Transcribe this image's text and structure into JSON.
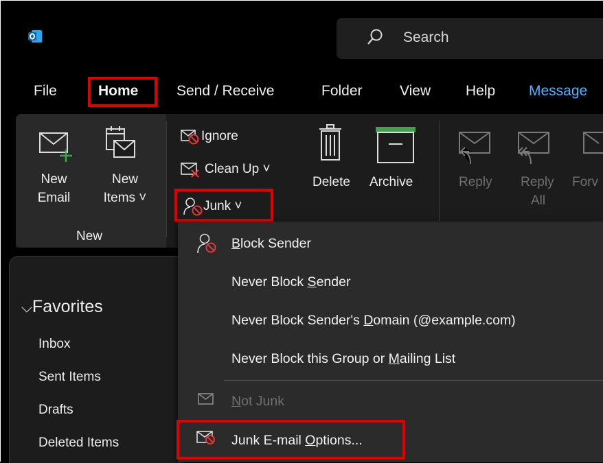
{
  "search": {
    "placeholder": "Search"
  },
  "menu_tabs": [
    "File",
    "Home",
    "Send / Receive",
    "Folder",
    "View",
    "Help",
    "Message"
  ],
  "ribbon": {
    "new_email": [
      "New",
      "Email"
    ],
    "new_items": [
      "New",
      "Items ˅"
    ],
    "group_new_label": "New",
    "ignore": "Ignore",
    "clean_up": "Clean Up ˅",
    "junk": "Junk ˅",
    "delete": "Delete",
    "archive": "Archive",
    "reply": "Reply",
    "reply_all": [
      "Reply",
      "All"
    ],
    "forward_partial": "Forv"
  },
  "nav": {
    "favorites": "Favorites",
    "items": [
      "Inbox",
      "Sent Items",
      "Drafts",
      "Deleted Items"
    ]
  },
  "junk_menu": {
    "block_sender": {
      "pre": "",
      "key": "B",
      "post": "lock Sender"
    },
    "never_block_sender": {
      "pre": "Never Block ",
      "key": "S",
      "post": "ender"
    },
    "never_block_domain": {
      "pre": "Never Block Sender's ",
      "key": "D",
      "post": "omain (@example.com)"
    },
    "never_block_group": {
      "pre": "Never Block this Group or ",
      "key": "M",
      "post": "ailing List"
    },
    "not_junk": {
      "pre": "",
      "key": "N",
      "post": "ot Junk"
    },
    "junk_options": {
      "pre": "Junk E-mail ",
      "key": "O",
      "post": "ptions..."
    }
  },
  "colors": {
    "accent_blue": "#4fb3ff",
    "highlight_red": "#e00000",
    "archive_green": "#3fa34d"
  }
}
